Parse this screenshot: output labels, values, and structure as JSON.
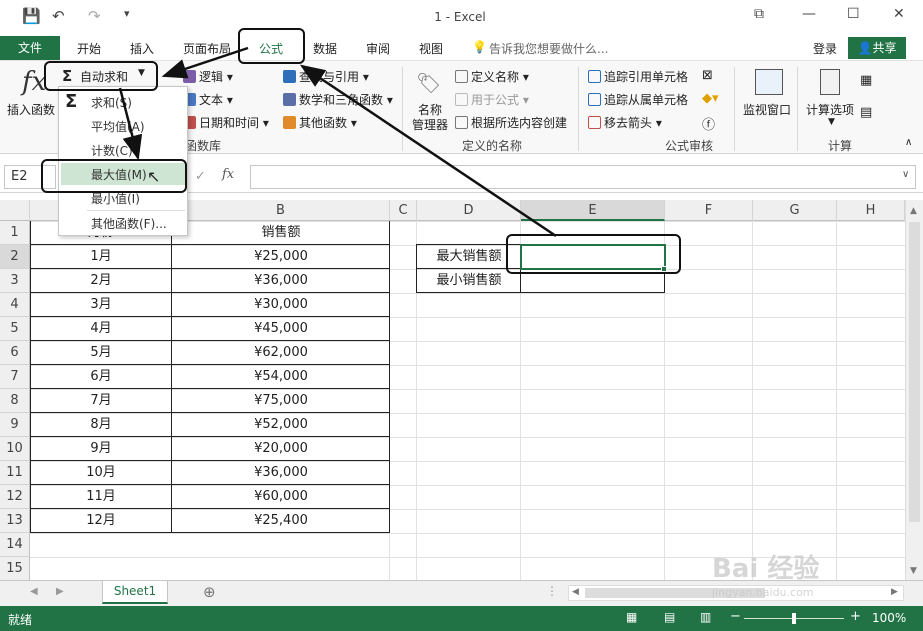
{
  "window": {
    "title": "1 - Excel"
  },
  "qat": {
    "save": "💾",
    "undo": "↶",
    "redo": "↷",
    "customize": "▾"
  },
  "window_controls": {
    "ribbon_options": "⧉",
    "minimize": "—",
    "maximize": "☐",
    "close": "✕"
  },
  "tabs": [
    "开始",
    "插入",
    "页面布局",
    "公式",
    "数据",
    "审阅",
    "视图"
  ],
  "file_tab": "文件",
  "tell_me": "告诉我您想要做什么...",
  "account": {
    "login": "登录",
    "share": "共享"
  },
  "ribbon": {
    "insert_function": "插入函数",
    "autosum": "自动求和",
    "logical": "逻辑",
    "text": "文本",
    "datetime": "日期和时间",
    "lookup": "查找与引用",
    "math": "数学和三角函数",
    "other": "其他函数",
    "function_library": "函数库",
    "name_manager_1": "名称",
    "name_manager_2": "管理器",
    "define_name": "定义名称",
    "use_in_formula": "用于公式",
    "create_from_selection": "根据所选内容创建",
    "defined_names": "定义的名称",
    "trace_precedents": "追踪引用单元格",
    "trace_dependents": "追踪从属单元格",
    "remove_arrows": "移去箭头",
    "formula_auditing": "公式审核",
    "watch_window": "监视窗口",
    "calc_options": "计算选项",
    "calculation": "计算"
  },
  "dropdown": [
    "求和(S)",
    "平均值(A)",
    "计数(C)",
    "最大值(M)",
    "最小值(I)",
    "其他函数(F)..."
  ],
  "namebox": "E2",
  "fx": "fx",
  "columns": [
    "A",
    "B",
    "C",
    "D",
    "E",
    "F",
    "G",
    "H"
  ],
  "rows": [
    "1",
    "2",
    "3",
    "4",
    "5",
    "6",
    "7",
    "8",
    "9",
    "10",
    "11",
    "12",
    "13",
    "14",
    "15"
  ],
  "table": {
    "header_a": "月份",
    "header_b": "销售额",
    "months": [
      "1月",
      "2月",
      "3月",
      "4月",
      "5月",
      "6月",
      "7月",
      "8月",
      "9月",
      "10月",
      "11月",
      "12月"
    ],
    "sales": [
      "¥25,000",
      "¥36,000",
      "¥30,000",
      "¥45,000",
      "¥62,000",
      "¥54,000",
      "¥75,000",
      "¥52,000",
      "¥20,000",
      "¥36,000",
      "¥60,000",
      "¥25,400"
    ]
  },
  "summary": {
    "max_label": "最大销售额",
    "min_label": "最小销售额"
  },
  "sheet_tab": "Sheet1",
  "add_sheet": "⊕",
  "status": {
    "ready": "就绪",
    "zoom": "100%"
  },
  "watermark": "Bai 经验",
  "watermark_url": "jingyan.baidu.com"
}
